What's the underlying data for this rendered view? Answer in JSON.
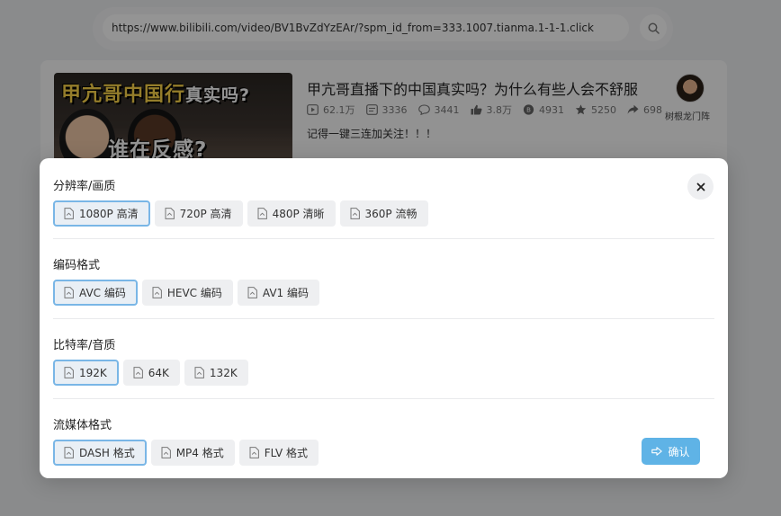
{
  "browser": {
    "url": "https://www.bilibili.com/video/BV1BvZdYzEAr/?spm_id_from=333.1007.tianma.1-1-1.click",
    "search_icon": "search-icon"
  },
  "video": {
    "thumbnail_title_a": "甲亢哥中国行",
    "thumbnail_title_b": "真实吗?",
    "thumbnail_subtitle": "谁在反感?",
    "title": "甲亢哥直播下的中国真实吗？为什么有些人会不舒服",
    "description": "记得一键三连加关注！！！",
    "stats": [
      {
        "icon": "play-icon",
        "value": "62.1万"
      },
      {
        "icon": "danmaku-icon",
        "value": "3336"
      },
      {
        "icon": "comment-icon",
        "value": "3441"
      },
      {
        "icon": "like-icon",
        "value": "3.8万"
      },
      {
        "icon": "coin-icon",
        "value": "4931"
      },
      {
        "icon": "star-icon",
        "value": "5250"
      },
      {
        "icon": "share-icon",
        "value": "698"
      }
    ],
    "uploader": {
      "name": "树根龙门阵"
    }
  },
  "modal": {
    "close_icon": "close-icon",
    "sections": [
      {
        "label": "分辨率/画质",
        "options": [
          {
            "label": "1080P 高清",
            "selected": true
          },
          {
            "label": "720P 高清",
            "selected": false
          },
          {
            "label": "480P 清晰",
            "selected": false
          },
          {
            "label": "360P 流畅",
            "selected": false
          }
        ]
      },
      {
        "label": "编码格式",
        "options": [
          {
            "label": "AVC 编码",
            "selected": true
          },
          {
            "label": "HEVC 编码",
            "selected": false
          },
          {
            "label": "AV1 编码",
            "selected": false
          }
        ]
      },
      {
        "label": "比特率/音质",
        "options": [
          {
            "label": "192K",
            "selected": true
          },
          {
            "label": "64K",
            "selected": false
          },
          {
            "label": "132K",
            "selected": false
          }
        ]
      },
      {
        "label": "流媒体格式",
        "options": [
          {
            "label": "DASH 格式",
            "selected": true
          },
          {
            "label": "MP4 格式",
            "selected": false
          },
          {
            "label": "FLV 格式",
            "selected": false
          }
        ]
      }
    ],
    "confirm_label": "确认"
  },
  "colors": {
    "accent": "#5fb3e6",
    "selected_border": "#79b6e6",
    "option_bg": "#eeeff1"
  }
}
